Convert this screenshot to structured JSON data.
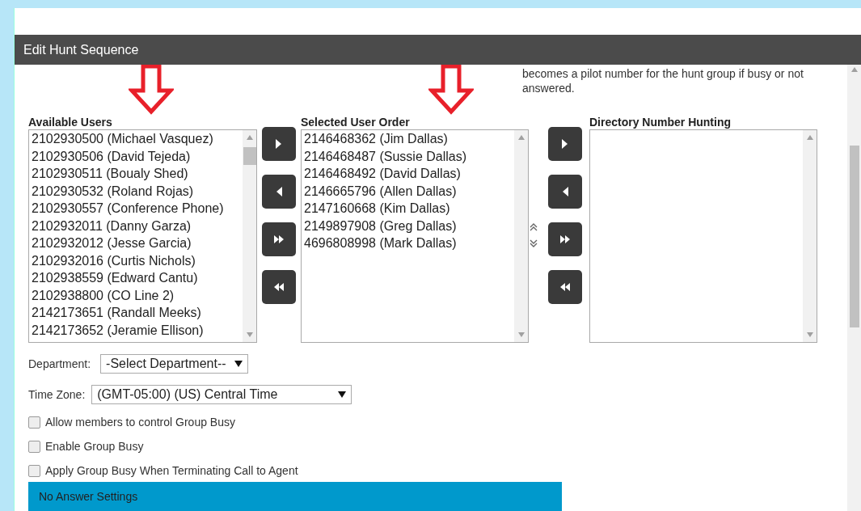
{
  "dialog": {
    "title": "Edit Hunt Sequence"
  },
  "note": "becomes a pilot number for the hunt group if busy or not answered.",
  "available_users": {
    "label": "Available Users",
    "items": [
      "2102930500 (Michael Vasquez)",
      "2102930506 (David Tejeda)",
      "2102930511 (Boualy Shed)",
      "2102930532 (Roland Rojas)",
      "2102930557 (Conference Phone)",
      "2102932011 (Danny Garza)",
      "2102932012 (Jesse Garcia)",
      "2102932016 (Curtis Nichols)",
      "2102938559 (Edward Cantu)",
      "2102938800 (CO Line 2)",
      "2142173651 (Randall Meeks)",
      "2142173652 (Jeramie Ellison)"
    ]
  },
  "selected_user_order": {
    "label": "Selected User Order",
    "items": [
      "2146468362 (Jim Dallas)",
      "2146468487 (Sussie Dallas)",
      "2146468492 (David Dallas)",
      "2146665796 (Allen Dallas)",
      "2147160668 (Kim Dallas)",
      "2149897908 (Greg Dallas)",
      "4696808998 (Mark Dallas)"
    ]
  },
  "directory_number_hunting": {
    "label": "Directory Number Hunting"
  },
  "department": {
    "label": "Department:",
    "value": "-Select Department--"
  },
  "time_zone": {
    "label": "Time Zone:",
    "value": "(GMT-05:00) (US) Central Time"
  },
  "options": [
    {
      "label": "Allow members to control Group Busy",
      "checked": false
    },
    {
      "label": "Enable Group Busy",
      "checked": false
    },
    {
      "label": "Apply Group Busy When Terminating Call to Agent",
      "checked": false
    }
  ],
  "section": {
    "title": "No Answer Settings"
  }
}
